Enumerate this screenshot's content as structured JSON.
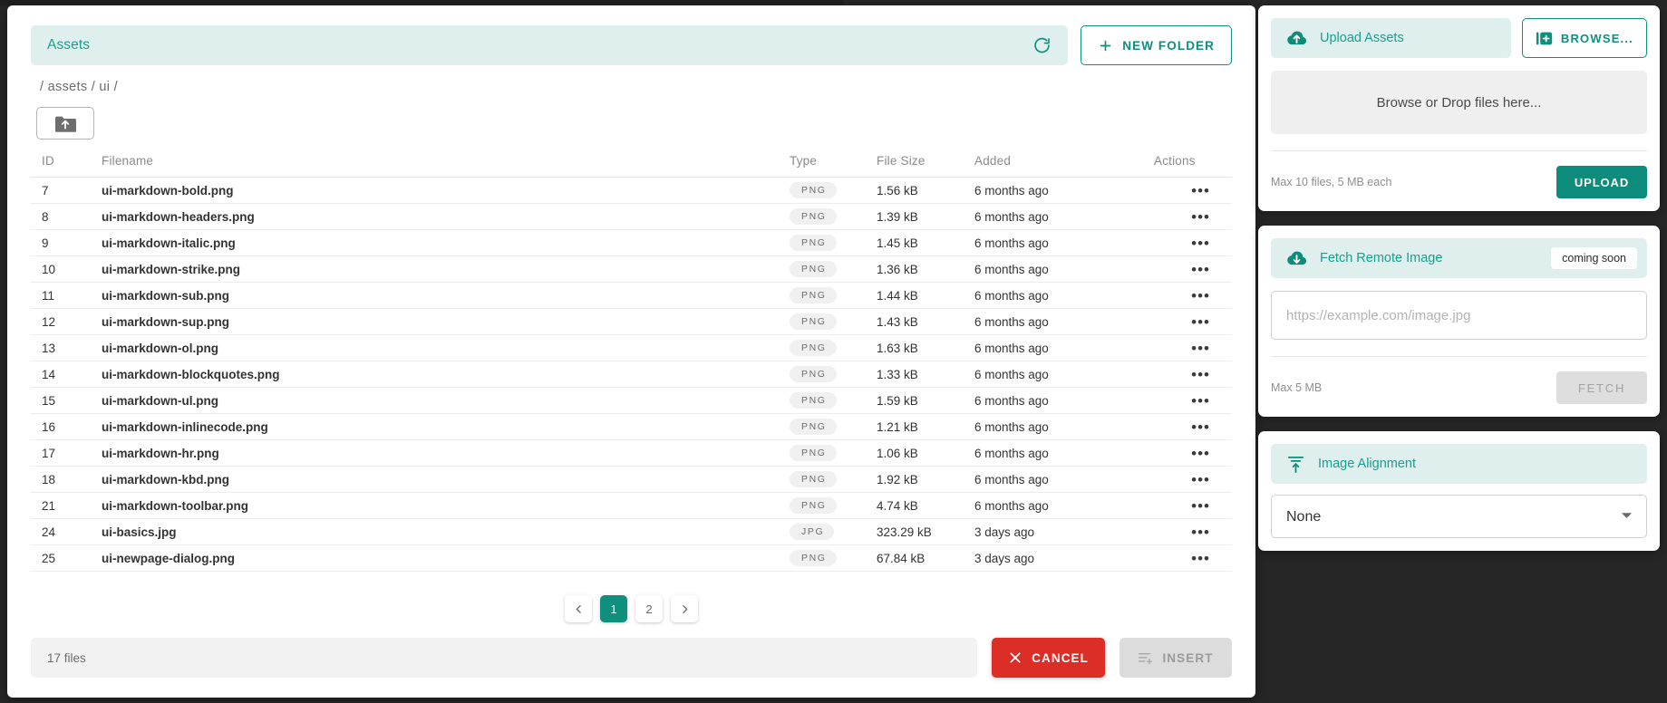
{
  "dialog": {
    "title": "Assets",
    "refresh_icon": "refresh-icon",
    "new_folder_label": "NEW FOLDER",
    "new_folder_icon": "plus-icon",
    "breadcrumb": "/ assets / ui /",
    "folder_up_icon": "folder-up-icon"
  },
  "table": {
    "columns": [
      "ID",
      "Filename",
      "Type",
      "File Size",
      "Added",
      "Actions"
    ],
    "row_action_icon": "ellipsis-icon",
    "rows": [
      {
        "id": "7",
        "filename": "ui-markdown-bold.png",
        "type": "PNG",
        "size": "1.56 kB",
        "added": "6 months ago"
      },
      {
        "id": "8",
        "filename": "ui-markdown-headers.png",
        "type": "PNG",
        "size": "1.39 kB",
        "added": "6 months ago"
      },
      {
        "id": "9",
        "filename": "ui-markdown-italic.png",
        "type": "PNG",
        "size": "1.45 kB",
        "added": "6 months ago"
      },
      {
        "id": "10",
        "filename": "ui-markdown-strike.png",
        "type": "PNG",
        "size": "1.36 kB",
        "added": "6 months ago"
      },
      {
        "id": "11",
        "filename": "ui-markdown-sub.png",
        "type": "PNG",
        "size": "1.44 kB",
        "added": "6 months ago"
      },
      {
        "id": "12",
        "filename": "ui-markdown-sup.png",
        "type": "PNG",
        "size": "1.43 kB",
        "added": "6 months ago"
      },
      {
        "id": "13",
        "filename": "ui-markdown-ol.png",
        "type": "PNG",
        "size": "1.63 kB",
        "added": "6 months ago"
      },
      {
        "id": "14",
        "filename": "ui-markdown-blockquotes.png",
        "type": "PNG",
        "size": "1.33 kB",
        "added": "6 months ago"
      },
      {
        "id": "15",
        "filename": "ui-markdown-ul.png",
        "type": "PNG",
        "size": "1.59 kB",
        "added": "6 months ago"
      },
      {
        "id": "16",
        "filename": "ui-markdown-inlinecode.png",
        "type": "PNG",
        "size": "1.21 kB",
        "added": "6 months ago"
      },
      {
        "id": "17",
        "filename": "ui-markdown-hr.png",
        "type": "PNG",
        "size": "1.06 kB",
        "added": "6 months ago"
      },
      {
        "id": "18",
        "filename": "ui-markdown-kbd.png",
        "type": "PNG",
        "size": "1.92 kB",
        "added": "6 months ago"
      },
      {
        "id": "21",
        "filename": "ui-markdown-toolbar.png",
        "type": "PNG",
        "size": "4.74 kB",
        "added": "6 months ago"
      },
      {
        "id": "24",
        "filename": "ui-basics.jpg",
        "type": "JPG",
        "size": "323.29 kB",
        "added": "3 days ago"
      },
      {
        "id": "25",
        "filename": "ui-newpage-dialog.png",
        "type": "PNG",
        "size": "67.84 kB",
        "added": "3 days ago"
      }
    ]
  },
  "pagination": {
    "prev_icon": "chevron-left-icon",
    "next_icon": "chevron-right-icon",
    "pages": [
      "1",
      "2"
    ],
    "active_page": "1"
  },
  "footer": {
    "file_count": "17 files",
    "cancel_label": "CANCEL",
    "cancel_icon": "close-x-icon",
    "insert_label": "INSERT",
    "insert_icon": "insert-list-icon"
  },
  "upload_card": {
    "banner_label": "Upload Assets",
    "banner_icon": "cloud-upload-icon",
    "browse_label": "BROWSE...",
    "browse_icon": "browse-files-icon",
    "dropzone_text": "Browse or Drop files here...",
    "hint": "Max 10 files, 5 MB each",
    "upload_label": "UPLOAD"
  },
  "fetch_card": {
    "banner_label": "Fetch Remote Image",
    "banner_icon": "cloud-download-icon",
    "badge": "coming soon",
    "url_placeholder": "https://example.com/image.jpg",
    "url_value": "",
    "hint": "Max 5 MB",
    "fetch_label": "FETCH"
  },
  "alignment_card": {
    "banner_label": "Image Alignment",
    "banner_icon": "align-top-icon",
    "selected": "None",
    "options": [
      "None"
    ],
    "caret_icon": "chevron-down-icon"
  },
  "colors": {
    "accent": "#0f8f7e",
    "banner_bg": "#deefed",
    "danger": "#dd2d27",
    "backdrop": "#262626"
  }
}
